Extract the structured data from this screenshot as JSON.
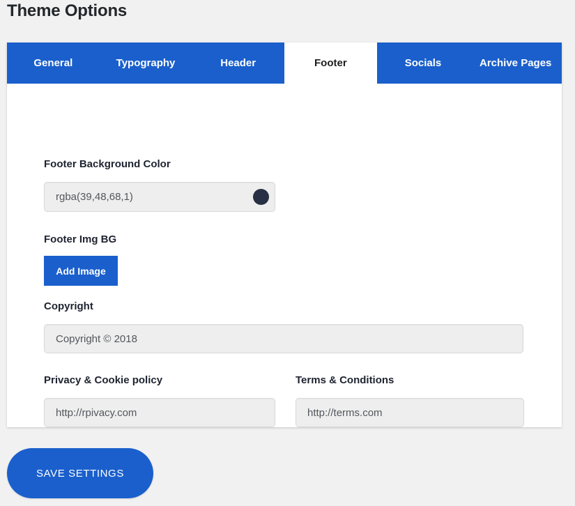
{
  "page": {
    "title": "Theme Options"
  },
  "tabs": [
    {
      "label": "General",
      "active": false
    },
    {
      "label": "Typography",
      "active": false
    },
    {
      "label": "Header",
      "active": false
    },
    {
      "label": "Footer",
      "active": true
    },
    {
      "label": "Socials",
      "active": false
    },
    {
      "label": "Archive Pages",
      "active": false
    }
  ],
  "footer_panel": {
    "background_color": {
      "label": "Footer Background Color",
      "value": "rgba(39,48,68,1)",
      "swatch_color": "#273044"
    },
    "image_bg": {
      "label": "Footer Img BG",
      "button_label": "Add Image"
    },
    "copyright": {
      "label": "Copyright",
      "value": "Copyright © 2018"
    },
    "privacy": {
      "label": "Privacy & Cookie policy",
      "value": "http://rpivacy.com"
    },
    "terms": {
      "label": "Terms & Conditions",
      "value": "http://terms.com"
    }
  },
  "actions": {
    "save_label": "SAVE SETTINGS"
  },
  "colors": {
    "accent_blue": "#1a5fcc",
    "page_background": "#f1f1f1",
    "input_background": "#eeeeee"
  }
}
